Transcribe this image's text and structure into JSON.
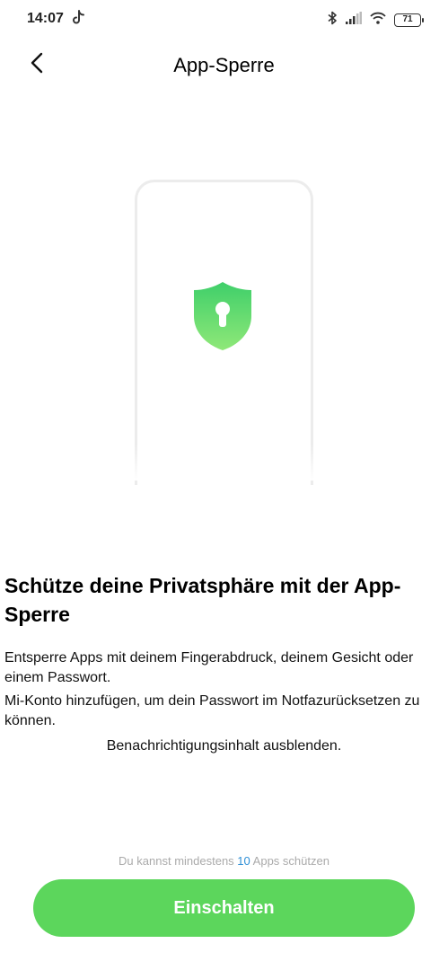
{
  "status_bar": {
    "time": "14:07",
    "battery": "71",
    "icons": [
      "tiktok-icon",
      "bluetooth-icon",
      "signal-icon",
      "wifi-icon",
      "battery-icon"
    ]
  },
  "header": {
    "title": "App-Sperre",
    "back_icon": "chevron-left-icon"
  },
  "illustration": {
    "icon": "shield-lock-icon",
    "shield_color_top": "#3fcf6a",
    "shield_color_bottom": "#8fe878"
  },
  "content": {
    "headline": "Schütze deine Privatsphäre mit der App-Sperre",
    "description_1": "Entsperre Apps mit deinem Fingerabdruck, deinem Gesicht oder einem Passwort.",
    "description_2": "Mi-Konto hinzufügen, um dein Passwort im Notfazurücksetzen zu können.",
    "description_3": "Benachrichtigungsinhalt ausblenden."
  },
  "hint": {
    "prefix": "Du kannst mindestens",
    "count": "10",
    "suffix": "Apps schützen"
  },
  "primary_button": {
    "label": "Einschalten",
    "color": "#5cd65c"
  }
}
